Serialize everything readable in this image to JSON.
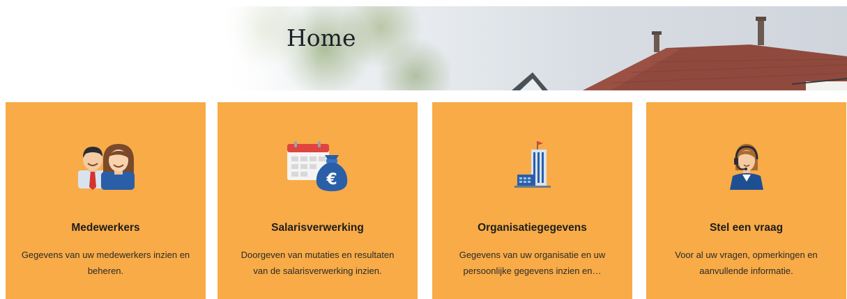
{
  "banner": {
    "title": "Home"
  },
  "cards": [
    {
      "title": "Medewerkers",
      "description": "Gegevens van uw medewerkers inzien en beheren.",
      "icon": "employees-icon"
    },
    {
      "title": "Salarisverwerking",
      "description": "Doorgeven van mutaties en resultaten van de salarisverwerking inzien.",
      "icon": "payroll-icon"
    },
    {
      "title": "Organisatiegegevens",
      "description": "Gegevens van uw organisatie en uw persoonlijke gegevens inzien en…",
      "icon": "building-icon"
    },
    {
      "title": "Stel een vraag",
      "description": "Voor al uw vragen, opmerkingen en aanvullende informatie.",
      "icon": "support-agent-icon"
    }
  ],
  "colors": {
    "card_background": "#f8ab47",
    "title_text": "#1c1f2a"
  }
}
